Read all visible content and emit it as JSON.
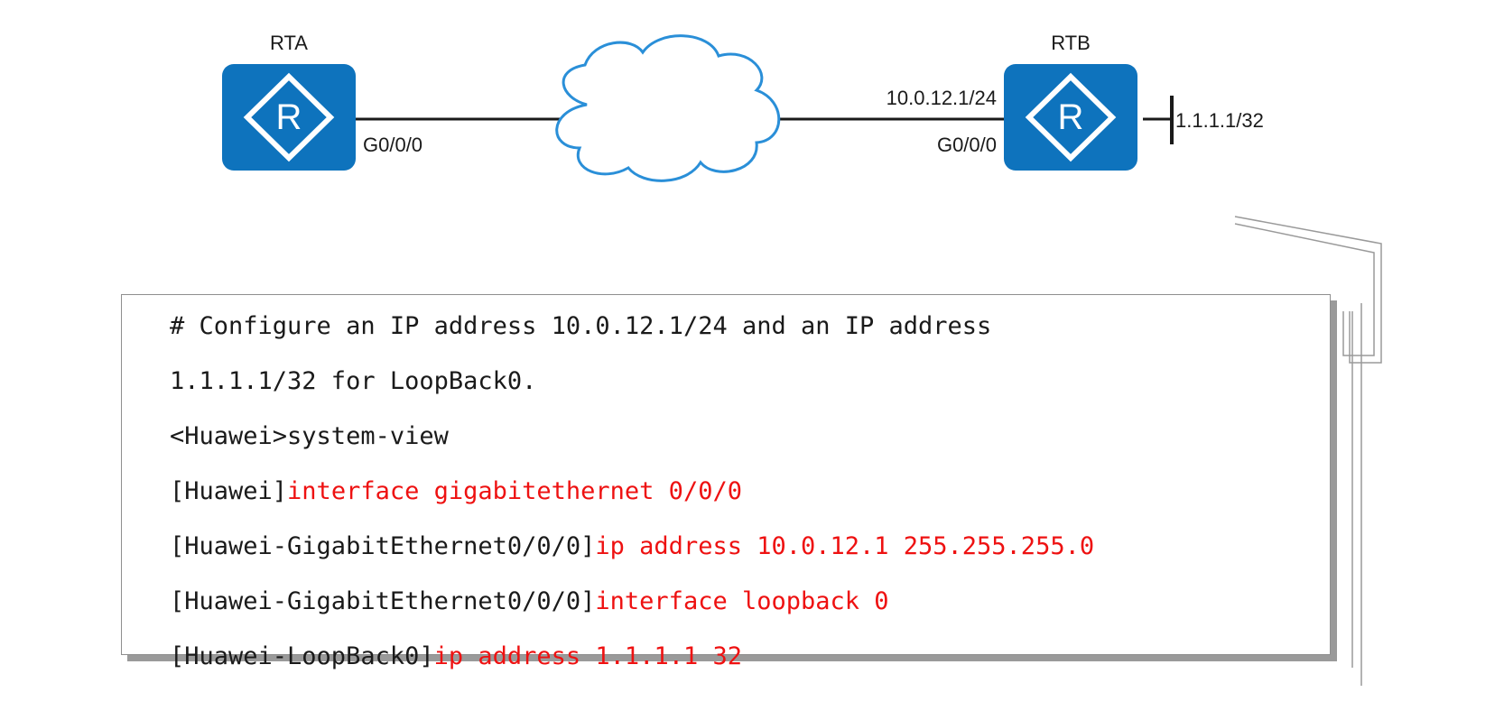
{
  "diagram": {
    "routers": [
      {
        "name": "RTA",
        "symbol": "R",
        "port": "G0/0/0",
        "color": "#0e73bd"
      },
      {
        "name": "RTB",
        "symbol": "R",
        "port": "G0/0/0",
        "ip": "10.0.12.1/24",
        "loopback": "1.1.1.1/32",
        "color": "#0e73bd"
      }
    ],
    "cloud_color": "#2a8fd8"
  },
  "config": {
    "comment_line1": "# Configure an IP address 10.0.12.1/24 and an IP address",
    "comment_line2": "1.1.1.1/32 for LoopBack0.",
    "lines": [
      {
        "prompt": "<Huawei>system-view",
        "command": ""
      },
      {
        "prompt": "[Huawei]",
        "command": "interface gigabitethernet 0/0/0"
      },
      {
        "prompt": "[Huawei-GigabitEthernet0/0/0]",
        "command": "ip address 10.0.12.1 255.255.255.0"
      },
      {
        "prompt": "[Huawei-GigabitEthernet0/0/0]",
        "command": "interface loopback 0"
      },
      {
        "prompt": "[Huawei-LoopBack0]",
        "command": "ip address 1.1.1.1 32"
      }
    ],
    "command_color": "#ee1111"
  }
}
